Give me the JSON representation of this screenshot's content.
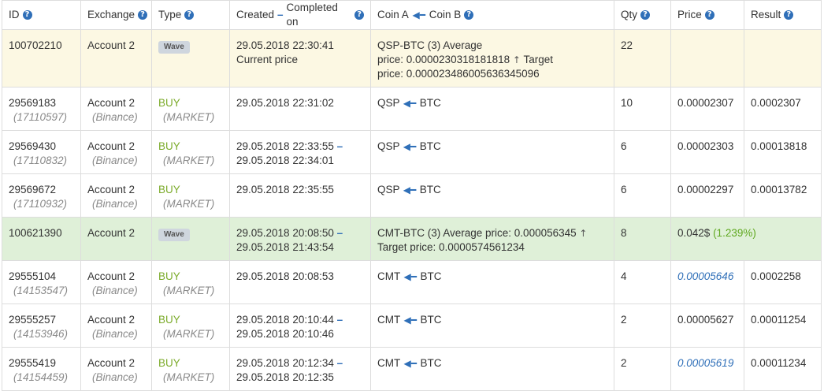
{
  "headers": {
    "id": "ID",
    "exchange": "Exchange",
    "type": "Type",
    "created": "Created",
    "completed": "Completed on",
    "coin_a": "Coin A",
    "coin_b": "Coin B",
    "qty": "Qty",
    "price": "Price",
    "result": "Result",
    "help_glyph": "?"
  },
  "rows": [
    {
      "id": "100702210",
      "exchange": "Account 2",
      "badge": "Wave",
      "created": "29.05.2018 22:30:41",
      "completed": "Current price",
      "coin_line1": "QSP-BTC (3)  Average",
      "coin_line2": "price: 0.0000230318181818",
      "coin_line2b": "Target",
      "coin_line3": "price: 0.000023486005636345096",
      "qty": "22"
    },
    {
      "id": "29569183",
      "sub_id": "(17110597)",
      "exchange": "Account 2",
      "exchange_sub": "(Binance)",
      "type": "BUY",
      "type_sub": "(MARKET)",
      "created": "29.05.2018 22:31:02",
      "coin_a": "QSP",
      "coin_b": "BTC",
      "qty": "10",
      "price": "0.00002307",
      "result": "0.0002307"
    },
    {
      "id": "29569430",
      "sub_id": "(17110832)",
      "exchange": "Account 2",
      "exchange_sub": "(Binance)",
      "type": "BUY",
      "type_sub": "(MARKET)",
      "created": "29.05.2018 22:33:55",
      "completed": "29.05.2018 22:34:01",
      "coin_a": "QSP",
      "coin_b": "BTC",
      "qty": "6",
      "price": "0.00002303",
      "result": "0.00013818"
    },
    {
      "id": "29569672",
      "sub_id": "(17110932)",
      "exchange": "Account 2",
      "exchange_sub": "(Binance)",
      "type": "BUY",
      "type_sub": "(MARKET)",
      "created": "29.05.2018 22:35:55",
      "coin_a": "QSP",
      "coin_b": "BTC",
      "qty": "6",
      "price": "0.00002297",
      "result": "0.00013782"
    },
    {
      "id": "100621390",
      "exchange": "Account 2",
      "badge": "Wave",
      "created": "29.05.2018 20:08:50",
      "completed": "29.05.2018 21:43:54",
      "coin_line1": "CMT-BTC (3)  Average price: 0.000056345",
      "coin_line2": "Target price: 0.0000574561234",
      "qty": "8",
      "price": "0.042$",
      "price_pct": "(1.239%)"
    },
    {
      "id": "29555104",
      "sub_id": "(14153547)",
      "exchange": "Account 2",
      "exchange_sub": "(Binance)",
      "type": "BUY",
      "type_sub": "(MARKET)",
      "created": "29.05.2018 20:08:53",
      "coin_a": "CMT",
      "coin_b": "BTC",
      "qty": "4",
      "price": "0.00005646",
      "result": "0.0002258"
    },
    {
      "id": "29555257",
      "sub_id": "(14153946)",
      "exchange": "Account 2",
      "exchange_sub": "(Binance)",
      "type": "BUY",
      "type_sub": "(MARKET)",
      "created": "29.05.2018 20:10:44",
      "completed": "29.05.2018 20:10:46",
      "coin_a": "CMT",
      "coin_b": "BTC",
      "qty": "2",
      "price": "0.00005627",
      "result": "0.00011254"
    },
    {
      "id": "29555419",
      "sub_id": "(14154459)",
      "exchange": "Account 2",
      "exchange_sub": "(Binance)",
      "type": "BUY",
      "type_sub": "(MARKET)",
      "created": "29.05.2018 20:12:34",
      "completed": "29.05.2018 20:12:35",
      "coin_a": "CMT",
      "coin_b": "BTC",
      "qty": "2",
      "price": "0.00005619",
      "result": "0.00011234"
    }
  ],
  "colors": {
    "accent": "#2f6fb8",
    "buy": "#7cab2b",
    "wave_pending_bg": "#fcf8e3",
    "wave_done_bg": "#dff0d8",
    "percent": "#5fa81f"
  },
  "icons": {
    "help": "question-circle-icon",
    "pair_arrow": "left-arrow-icon",
    "up_arrow": "up-arrow-icon"
  }
}
